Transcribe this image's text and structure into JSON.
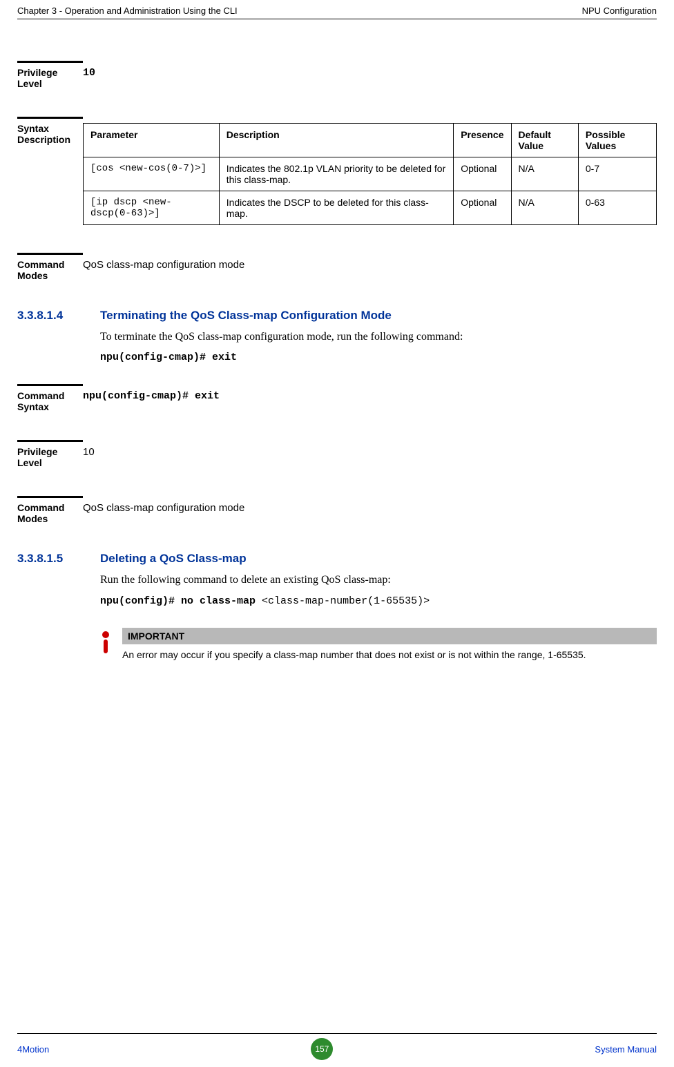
{
  "header": {
    "left": "Chapter 3 - Operation and Administration Using the CLI",
    "right": "NPU Configuration"
  },
  "blocks": {
    "privilege1": {
      "label": "Privilege Level",
      "value": "10"
    },
    "syntaxDesc": {
      "label": "Syntax Description"
    },
    "cmdModes1": {
      "label": "Command Modes",
      "value": "QoS class-map configuration mode"
    },
    "cmdSyntax": {
      "label": "Command Syntax",
      "value": "npu(config-cmap)# exit"
    },
    "privilege2": {
      "label": "Privilege Level",
      "value": "10"
    },
    "cmdModes2": {
      "label": "Command Modes",
      "value": "QoS class-map configuration mode"
    }
  },
  "syntax_table": {
    "headers": {
      "c1": "Parameter",
      "c2": "Description",
      "c3": "Presence",
      "c4": "Default Value",
      "c5": "Possible Values"
    },
    "row1": {
      "param": "[cos <new-cos(0-7)>]",
      "desc": "Indicates the 802.1p VLAN priority to be deleted for this class-map.",
      "presence": "Optional",
      "default": "N/A",
      "possible": "0-7"
    },
    "row2": {
      "param": "[ip dscp <new-dscp(0-63)>]",
      "desc": "Indicates the DSCP to be deleted for this class-map.",
      "presence": "Optional",
      "default": "N/A",
      "possible": "0-63"
    }
  },
  "section1": {
    "num": "3.3.8.1.4",
    "heading": "Terminating the QoS Class-map Configuration Mode",
    "body": "To terminate the QoS class-map configuration mode, run the following command:",
    "code": "npu(config-cmap)# exit"
  },
  "section2": {
    "num": "3.3.8.1.5",
    "heading": "Deleting a QoS Class-map",
    "body": "Run the following command to delete an existing QoS class-map:",
    "code_bold": "npu(config)# no class-map ",
    "code_plain": "<class-map-number(1-65535)>"
  },
  "important": {
    "title": "IMPORTANT",
    "body": "An error may occur if you specify a class-map number that does not exist or is not within the range, 1-65535."
  },
  "footer": {
    "left": "4Motion",
    "page": "157",
    "right": "System Manual"
  }
}
